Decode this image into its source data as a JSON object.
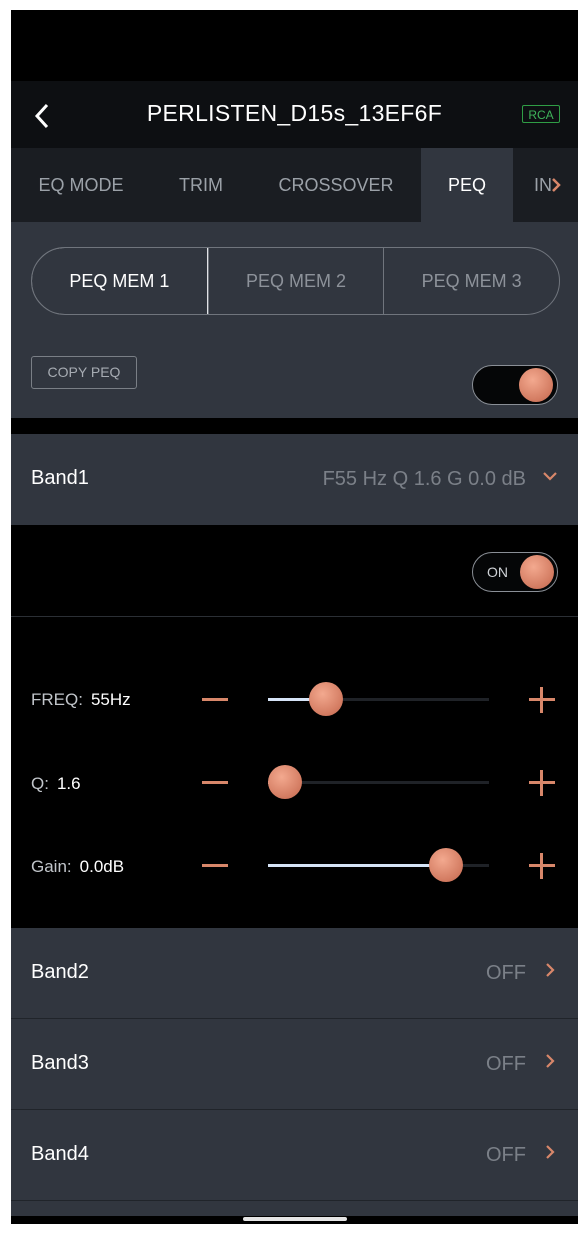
{
  "header": {
    "title": "PERLISTEN_D15s_13EF6F",
    "badge": "RCA"
  },
  "tabs": [
    {
      "label": "EQ MODE"
    },
    {
      "label": "TRIM"
    },
    {
      "label": "CROSSOVER"
    },
    {
      "label": "PEQ",
      "active": true
    },
    {
      "label": "IN"
    }
  ],
  "peq": {
    "memories": [
      "PEQ MEM 1",
      "PEQ MEM 2",
      "PEQ MEM 3"
    ],
    "active_memory": "PEQ MEM 1",
    "copy_label": "COPY PEQ",
    "enabled": true
  },
  "band1": {
    "name": "Band1",
    "summary": "F55 Hz Q 1.6 G 0.0 dB",
    "on_label": "ON",
    "params": {
      "freq": {
        "label": "FREQ:",
        "value": "55Hz",
        "level": 0.22
      },
      "q": {
        "label": "Q:",
        "value": "1.6",
        "level": 0.0
      },
      "gain": {
        "label": "Gain:",
        "value": "0.0dB",
        "level": 0.86
      }
    }
  },
  "bands": [
    {
      "name": "Band2",
      "status": "OFF"
    },
    {
      "name": "Band3",
      "status": "OFF"
    },
    {
      "name": "Band4",
      "status": "OFF"
    }
  ],
  "colors": {
    "accent": "#d8876a",
    "panel": "#31363f",
    "badge": "#3fb35a"
  }
}
